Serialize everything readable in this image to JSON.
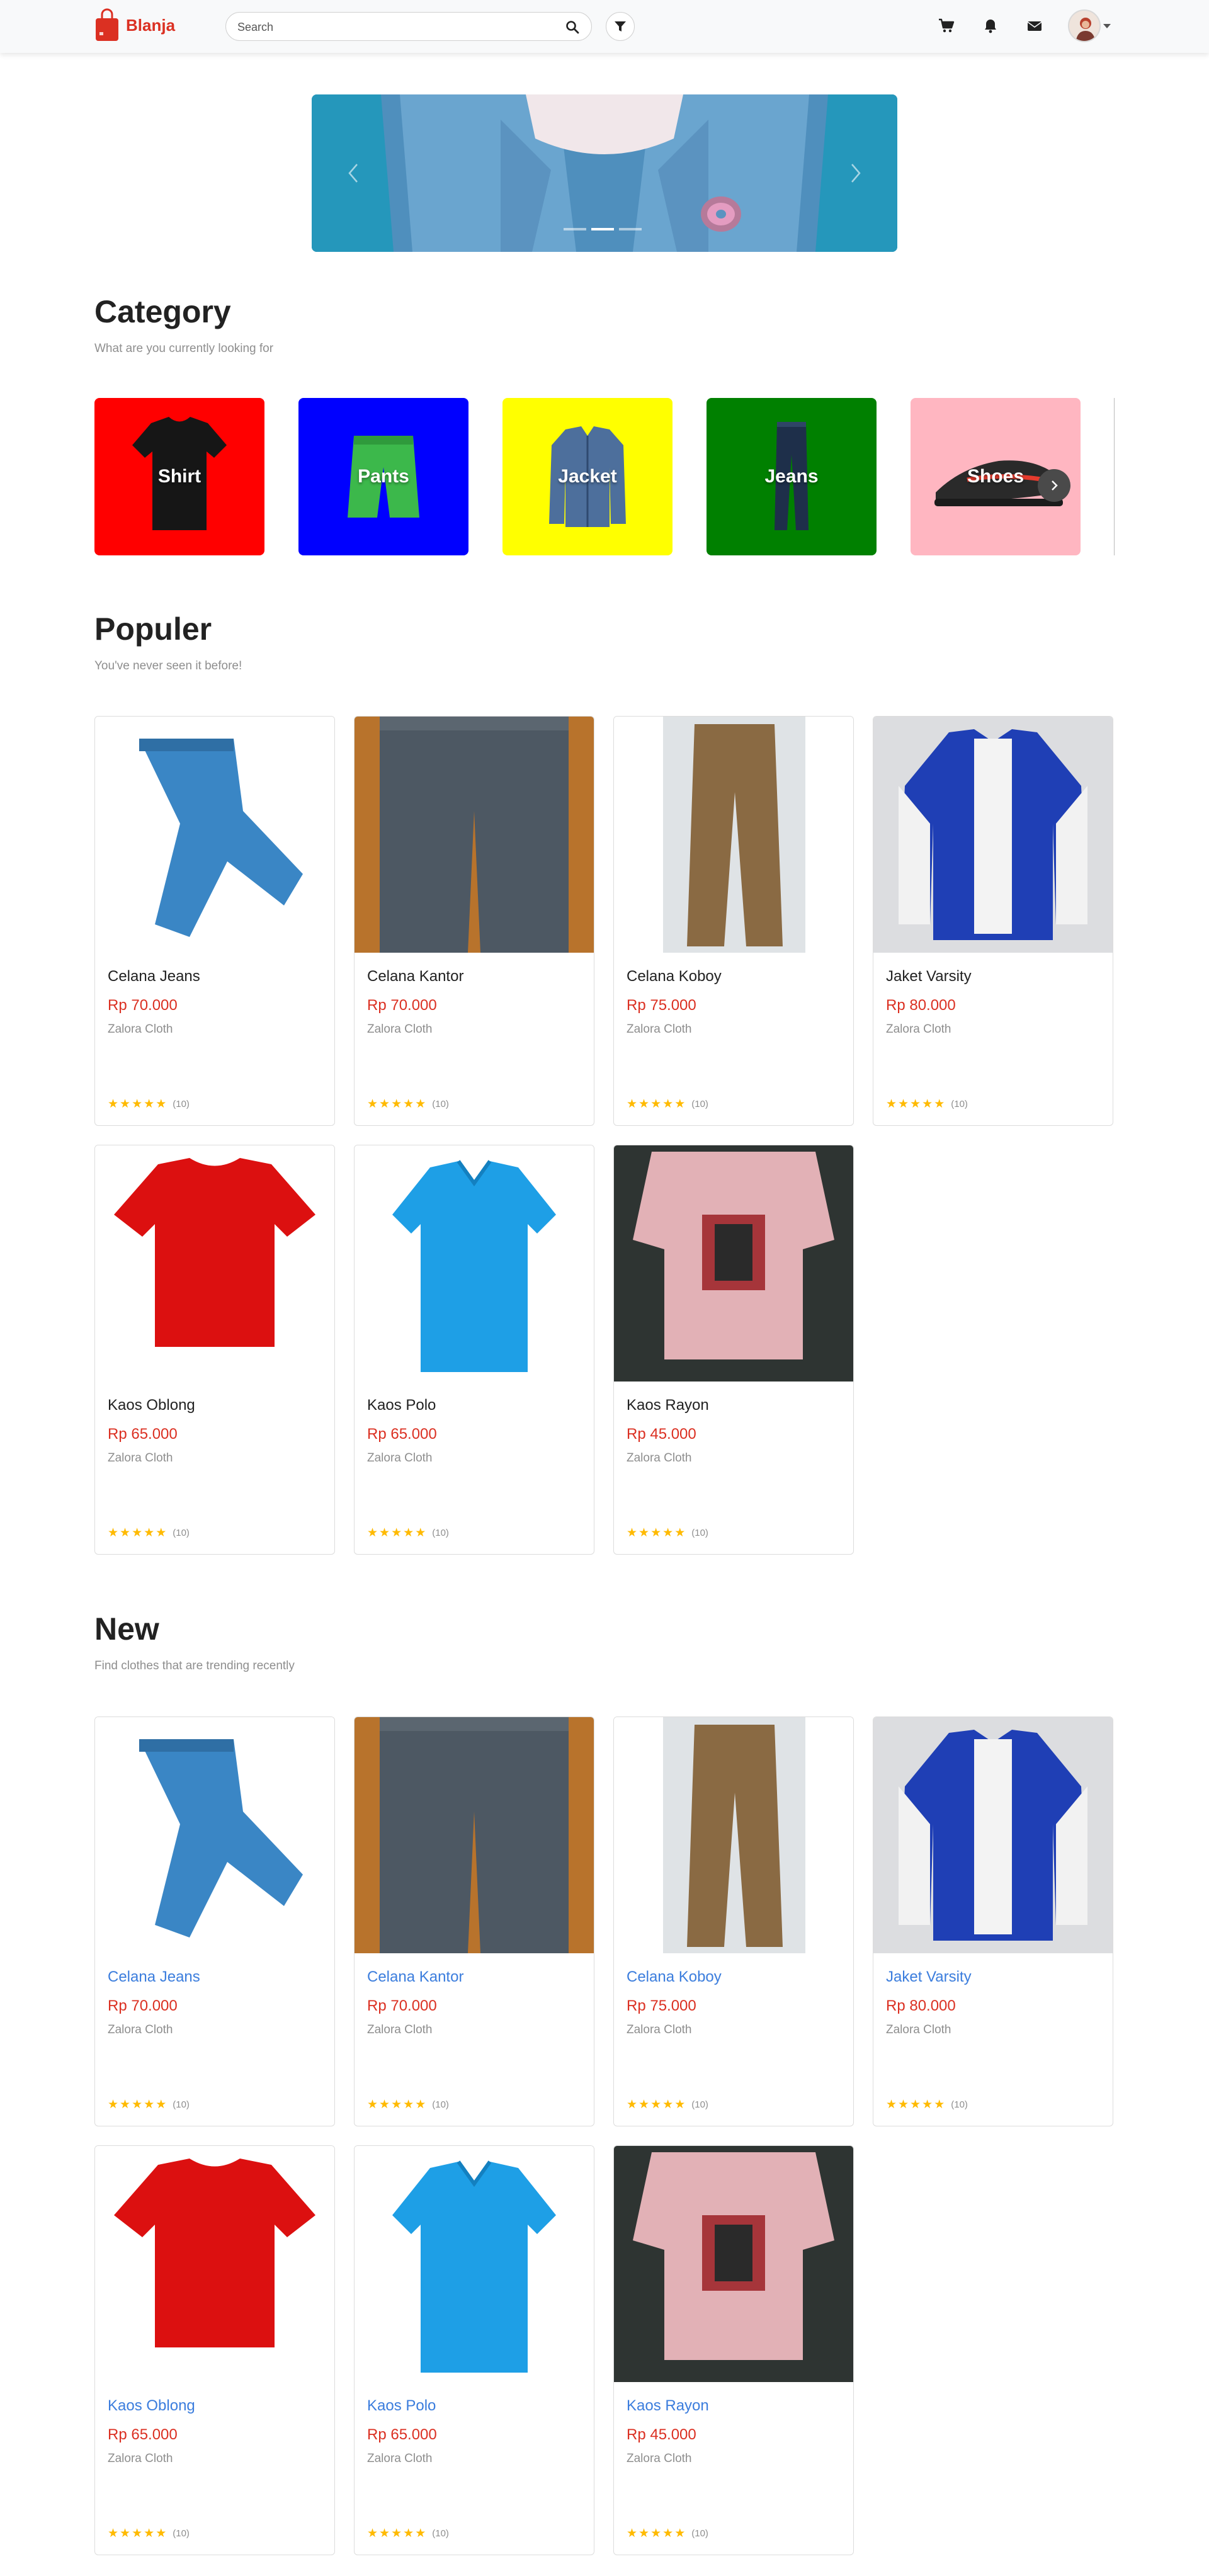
{
  "navbar": {
    "brand": "Blanja",
    "brand_color": "#db3022",
    "search": {
      "placeholder": "Search",
      "value": ""
    },
    "icons": [
      "search-icon",
      "filter-icon",
      "cart-icon",
      "bell-icon",
      "mail-icon",
      "avatar",
      "chevron-down-icon"
    ]
  },
  "banner": {
    "slide_count": 3,
    "active_slide": 2
  },
  "category": {
    "title": "Category",
    "subtitle": "What are you currently looking for",
    "items": [
      {
        "label": "Shirt",
        "color": "#ff0000",
        "icon": "tshirt-image"
      },
      {
        "label": "Pants",
        "color": "#0000ff",
        "icon": "shorts-image"
      },
      {
        "label": "Jacket",
        "color": "#ffff00",
        "icon": "jacket-image"
      },
      {
        "label": "Jeans",
        "color": "#008000",
        "icon": "jeans-image"
      },
      {
        "label": "Shoes",
        "color": "#ffb6c1",
        "icon": "sneaker-image"
      }
    ]
  },
  "populer": {
    "title": "Populer",
    "subtitle": "You've never seen it before!",
    "products": [
      {
        "name": "Celana Jeans",
        "price": "Rp 70.000",
        "seller": "Zalora Cloth",
        "rating": 5,
        "reviews": "(10)"
      },
      {
        "name": "Celana Kantor",
        "price": "Rp 70.000",
        "seller": "Zalora Cloth",
        "rating": 5,
        "reviews": "(10)"
      },
      {
        "name": "Celana Koboy",
        "price": "Rp 75.000",
        "seller": "Zalora Cloth",
        "rating": 5,
        "reviews": "(10)"
      },
      {
        "name": "Jaket Varsity",
        "price": "Rp 80.000",
        "seller": "Zalora Cloth",
        "rating": 5,
        "reviews": "(10)"
      },
      {
        "name": "Kaos Oblong",
        "price": "Rp 65.000",
        "seller": "Zalora Cloth",
        "rating": 5,
        "reviews": "(10)"
      },
      {
        "name": "Kaos Polo",
        "price": "Rp 65.000",
        "seller": "Zalora Cloth",
        "rating": 5,
        "reviews": "(10)"
      },
      {
        "name": "Kaos Rayon",
        "price": "Rp 45.000",
        "seller": "Zalora Cloth",
        "rating": 5,
        "reviews": "(10)"
      }
    ]
  },
  "new": {
    "title": "New",
    "subtitle": "Find clothes that are trending recently",
    "products": [
      {
        "name": "Celana Jeans",
        "price": "Rp 70.000",
        "seller": "Zalora Cloth",
        "rating": 5,
        "reviews": "(10)"
      },
      {
        "name": "Celana Kantor",
        "price": "Rp 70.000",
        "seller": "Zalora Cloth",
        "rating": 5,
        "reviews": "(10)"
      },
      {
        "name": "Celana Koboy",
        "price": "Rp 75.000",
        "seller": "Zalora Cloth",
        "rating": 5,
        "reviews": "(10)"
      },
      {
        "name": "Jaket Varsity",
        "price": "Rp 80.000",
        "seller": "Zalora Cloth",
        "rating": 5,
        "reviews": "(10)"
      },
      {
        "name": "Kaos Oblong",
        "price": "Rp 65.000",
        "seller": "Zalora Cloth",
        "rating": 5,
        "reviews": "(10)"
      },
      {
        "name": "Kaos Polo",
        "price": "Rp 65.000",
        "seller": "Zalora Cloth",
        "rating": 5,
        "reviews": "(10)"
      },
      {
        "name": "Kaos Rayon",
        "price": "Rp 45.000",
        "seller": "Zalora Cloth",
        "rating": 5,
        "reviews": "(10)"
      }
    ]
  }
}
